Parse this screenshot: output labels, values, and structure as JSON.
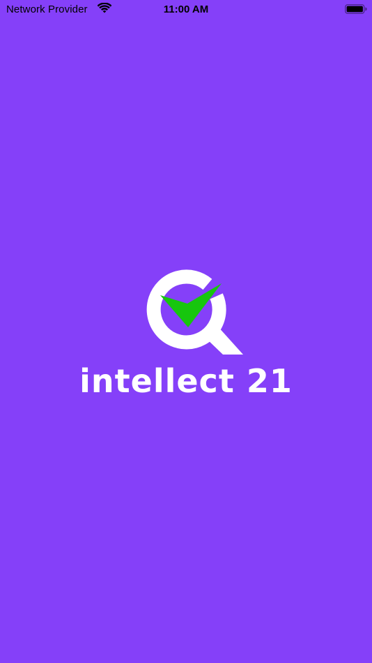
{
  "status_bar": {
    "carrier": "Network Provider",
    "time": "11:00 AM",
    "wifi_icon": "wifi-icon",
    "battery_icon": "battery-icon",
    "battery_level": 1.0
  },
  "splash": {
    "logo_icon": "magnifier-checkmark-icon",
    "brand_name": "intellect 21"
  },
  "colors": {
    "background": "#8540F9",
    "logo_ring": "#FFFFFF",
    "logo_check": "#17C60E",
    "brand_text": "#FFFFFF",
    "status_text": "#000000"
  }
}
